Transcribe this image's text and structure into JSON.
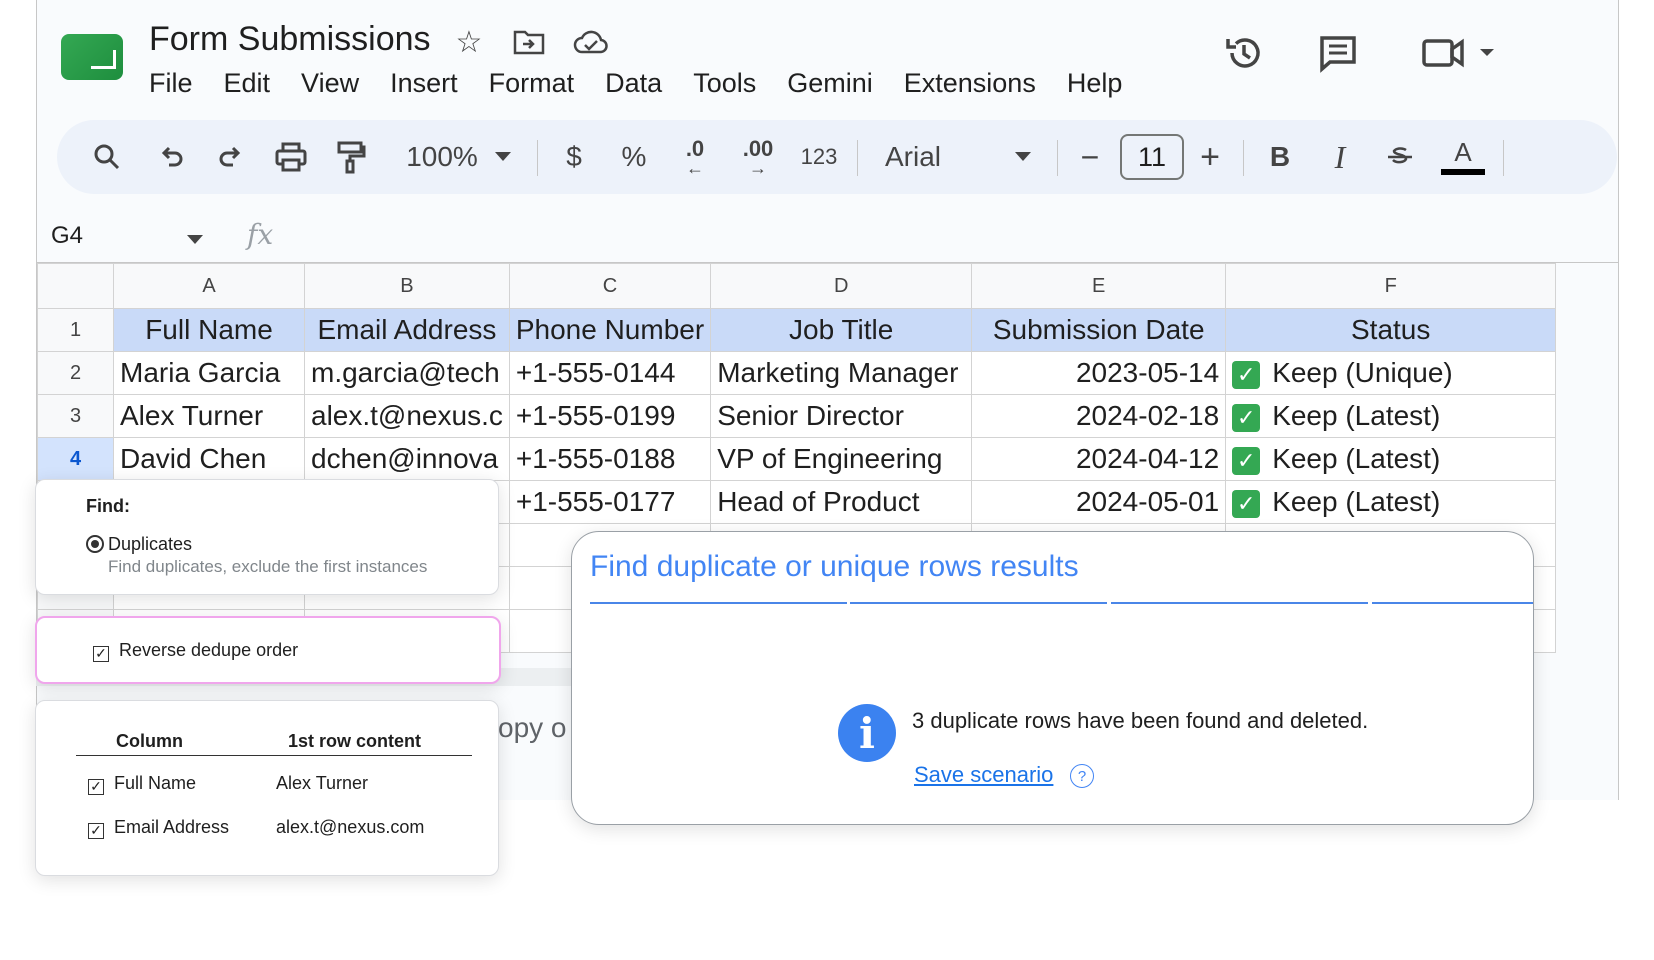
{
  "header": {
    "doc_title": "Form Submissions",
    "menu": [
      "File",
      "Edit",
      "View",
      "Insert",
      "Format",
      "Data",
      "Tools",
      "Gemini",
      "Extensions",
      "Help"
    ]
  },
  "toolbar": {
    "zoom": "100%",
    "currency": "$",
    "percent": "%",
    "dec_decrease": ".0",
    "dec_increase": ".00",
    "number_format": "123",
    "font": "Arial",
    "font_size": "11",
    "minus": "−",
    "plus": "+",
    "bold": "B",
    "italic": "I",
    "text_color": "A"
  },
  "formula_bar": {
    "cell_ref": "G4",
    "fx": "fx"
  },
  "grid": {
    "columns": [
      "A",
      "B",
      "C",
      "D",
      "E",
      "F"
    ],
    "row_numbers": [
      "1",
      "2",
      "3",
      "4"
    ],
    "header_row": [
      "Full Name",
      "Email Address",
      "Phone Number",
      "Job Title",
      "Submission Date",
      "Status"
    ],
    "rows": [
      [
        "Maria Garcia",
        "m.garcia@tech",
        "+1-555-0144",
        "Marketing Manager",
        "2023-05-14",
        "Keep (Unique)"
      ],
      [
        "Alex Turner",
        "alex.t@nexus.c",
        "+1-555-0199",
        "Senior Director",
        "2024-02-18",
        "Keep (Latest)"
      ],
      [
        "David Chen",
        "dchen@innova",
        "+1-555-0188",
        "VP of Engineering",
        "2024-04-12",
        "Keep (Latest)"
      ],
      [
        "",
        "",
        "+1-555-0177",
        "Head of Product",
        "2024-05-01",
        "Keep (Latest)"
      ]
    ],
    "copy_fragment": "opy o"
  },
  "find_panel": {
    "label": "Find:",
    "option": "Duplicates",
    "option_desc": "Find duplicates, exclude the first instances"
  },
  "reverse_panel": {
    "label": "Reverse dedupe order"
  },
  "columns_panel": {
    "col_header": "Column",
    "content_header": "1st row content",
    "rows": [
      {
        "column": "Full Name",
        "content": "Alex Turner"
      },
      {
        "column": "Email Address",
        "content": "alex.t@nexus.com"
      }
    ]
  },
  "results": {
    "title": "Find duplicate or unique rows results",
    "message": "3 duplicate rows have been found and deleted.",
    "save_link": "Save scenario",
    "help": "?"
  },
  "colors": {
    "header_fill": "#c9daf8",
    "accent_blue": "#4285f4",
    "check_green": "#34a853",
    "arrow_pink": "#f48fe8"
  }
}
